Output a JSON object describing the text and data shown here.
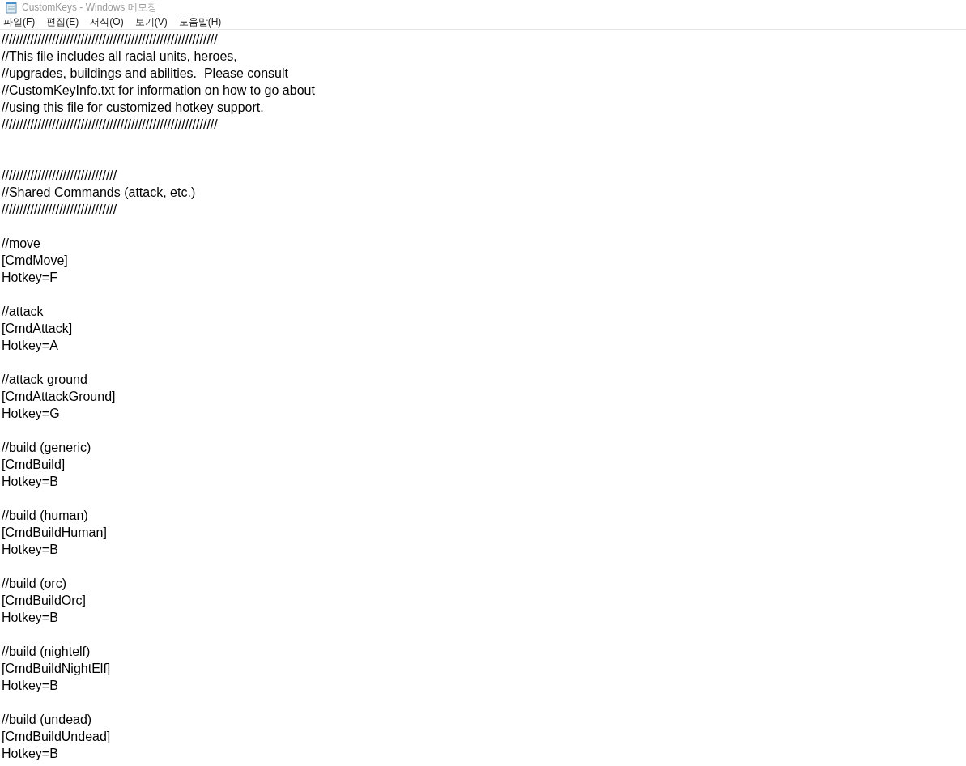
{
  "window": {
    "title": "CustomKeys - Windows 메모장"
  },
  "menu": [
    "파일(F)",
    "편집(E)",
    "서식(O)",
    "보기(V)",
    "도움말(H)"
  ],
  "blocks": [
    {
      "kind": "file-header",
      "lines": [
        "////////////////////////////////////////////////////////////",
        "//This file includes all racial units, heroes,",
        "//upgrades, buildings and abilities.  Please consult",
        "//CustomKeyInfo.txt for information on how to go about",
        "//using this file for customized hotkey support.",
        "////////////////////////////////////////////////////////////"
      ]
    },
    {
      "kind": "section",
      "lines": [
        "////////////////////////////////",
        "//Shared Commands (attack, etc.)",
        "////////////////////////////////"
      ]
    },
    {
      "kind": "section",
      "lines": [
        "//move",
        "[CmdMove]",
        "Hotkey=F"
      ]
    },
    {
      "kind": "section",
      "lines": [
        "//attack",
        "[CmdAttack]",
        "Hotkey=A"
      ]
    },
    {
      "kind": "section",
      "lines": [
        "//attack ground",
        "[CmdAttackGround]",
        "Hotkey=G"
      ]
    },
    {
      "kind": "section",
      "lines": [
        "//build (generic)",
        "[CmdBuild]",
        "Hotkey=B"
      ]
    },
    {
      "kind": "section",
      "lines": [
        "//build (human)",
        "[CmdBuildHuman]",
        "Hotkey=B"
      ]
    },
    {
      "kind": "section",
      "lines": [
        "//build (orc)",
        "[CmdBuildOrc]",
        "Hotkey=B"
      ]
    },
    {
      "kind": "section",
      "lines": [
        "//build (nightelf)",
        "[CmdBuildNightElf]",
        "Hotkey=B"
      ]
    },
    {
      "kind": "section",
      "lines": [
        "//build (undead)",
        "[CmdBuildUndead]",
        "Hotkey=B"
      ]
    }
  ]
}
